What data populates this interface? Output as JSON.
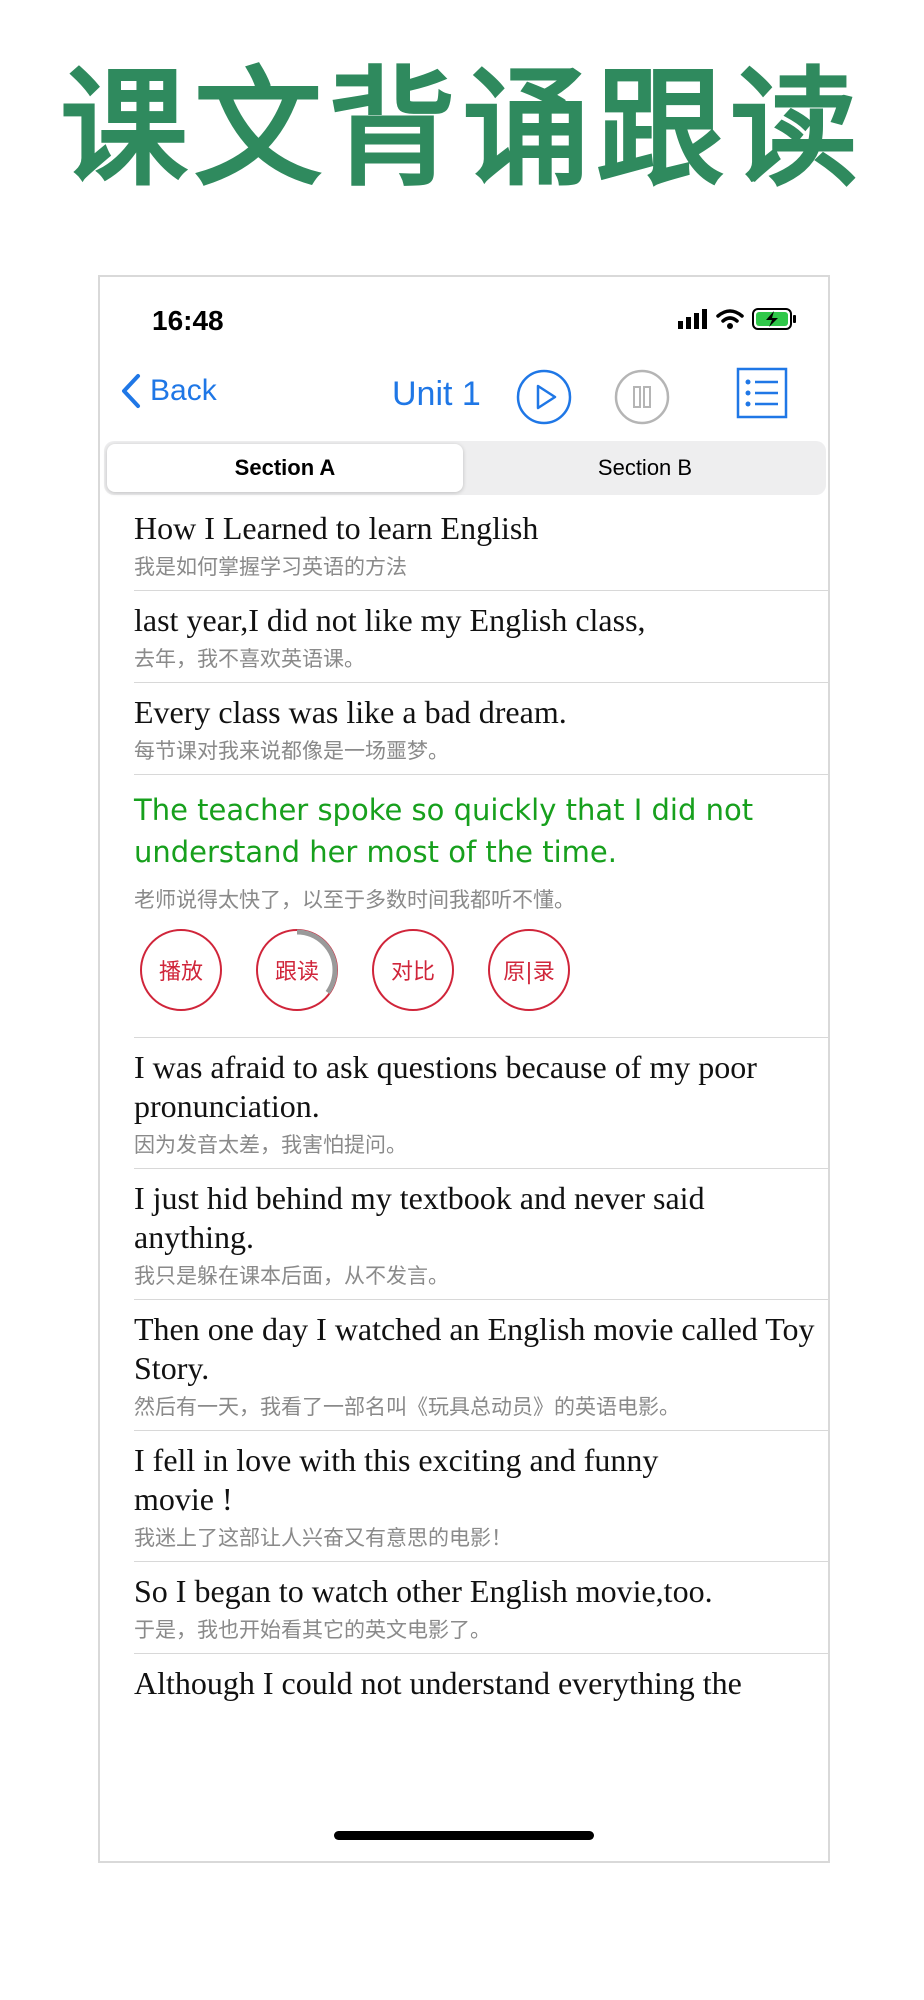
{
  "promo": {
    "title": "课文背诵跟读"
  },
  "status": {
    "time": "16:48"
  },
  "nav": {
    "back_label": "Back",
    "title": "Unit 1"
  },
  "tabs": [
    {
      "label": "Section A",
      "active": true
    },
    {
      "label": "Section B",
      "active": false
    }
  ],
  "sentences": [
    {
      "en": "How I Learned to learn English",
      "zh": "我是如何掌握学习英语的方法"
    },
    {
      "en": "last year,I did not like my English class,",
      "zh": "去年，我不喜欢英语课。"
    },
    {
      "en": "Every class was like a bad dream.",
      "zh": "每节课对我来说都像是一场噩梦。"
    },
    {
      "en": "The teacher spoke so quickly that I did not understand her most of the time.",
      "zh": "老师说得太快了，以至于多数时间我都听不懂。",
      "active": true
    },
    {
      "en": "I was afraid to ask questions because of my poor pronunciation.",
      "zh": "因为发音太差，我害怕提问。"
    },
    {
      "en": "I just hid behind my textbook and never said anything.",
      "zh": "我只是躲在课本后面，从不发言。"
    },
    {
      "en": "Then one day I watched an English movie called Toy Story.",
      "zh": "然后有一天，我看了一部名叫《玩具总动员》的英语电影。"
    },
    {
      "en": "I fell in love with this exciting and funny movie !",
      "zh": "我迷上了这部让人兴奋又有意思的电影！"
    },
    {
      "en": "So I began to watch other English movie,too.",
      "zh": "于是，我也开始看其它的英文电影了。"
    },
    {
      "en": "Although I could not understand everything the",
      "zh": ""
    }
  ],
  "controls": {
    "play": "播放",
    "follow": "跟读",
    "compare": "对比",
    "original_record": "原|录"
  },
  "follow_progress": 0.35,
  "colors": {
    "accent": "#1f77e6",
    "active_text": "#17a01d",
    "control": "#d0253a",
    "promo": "#2f8a5e"
  }
}
